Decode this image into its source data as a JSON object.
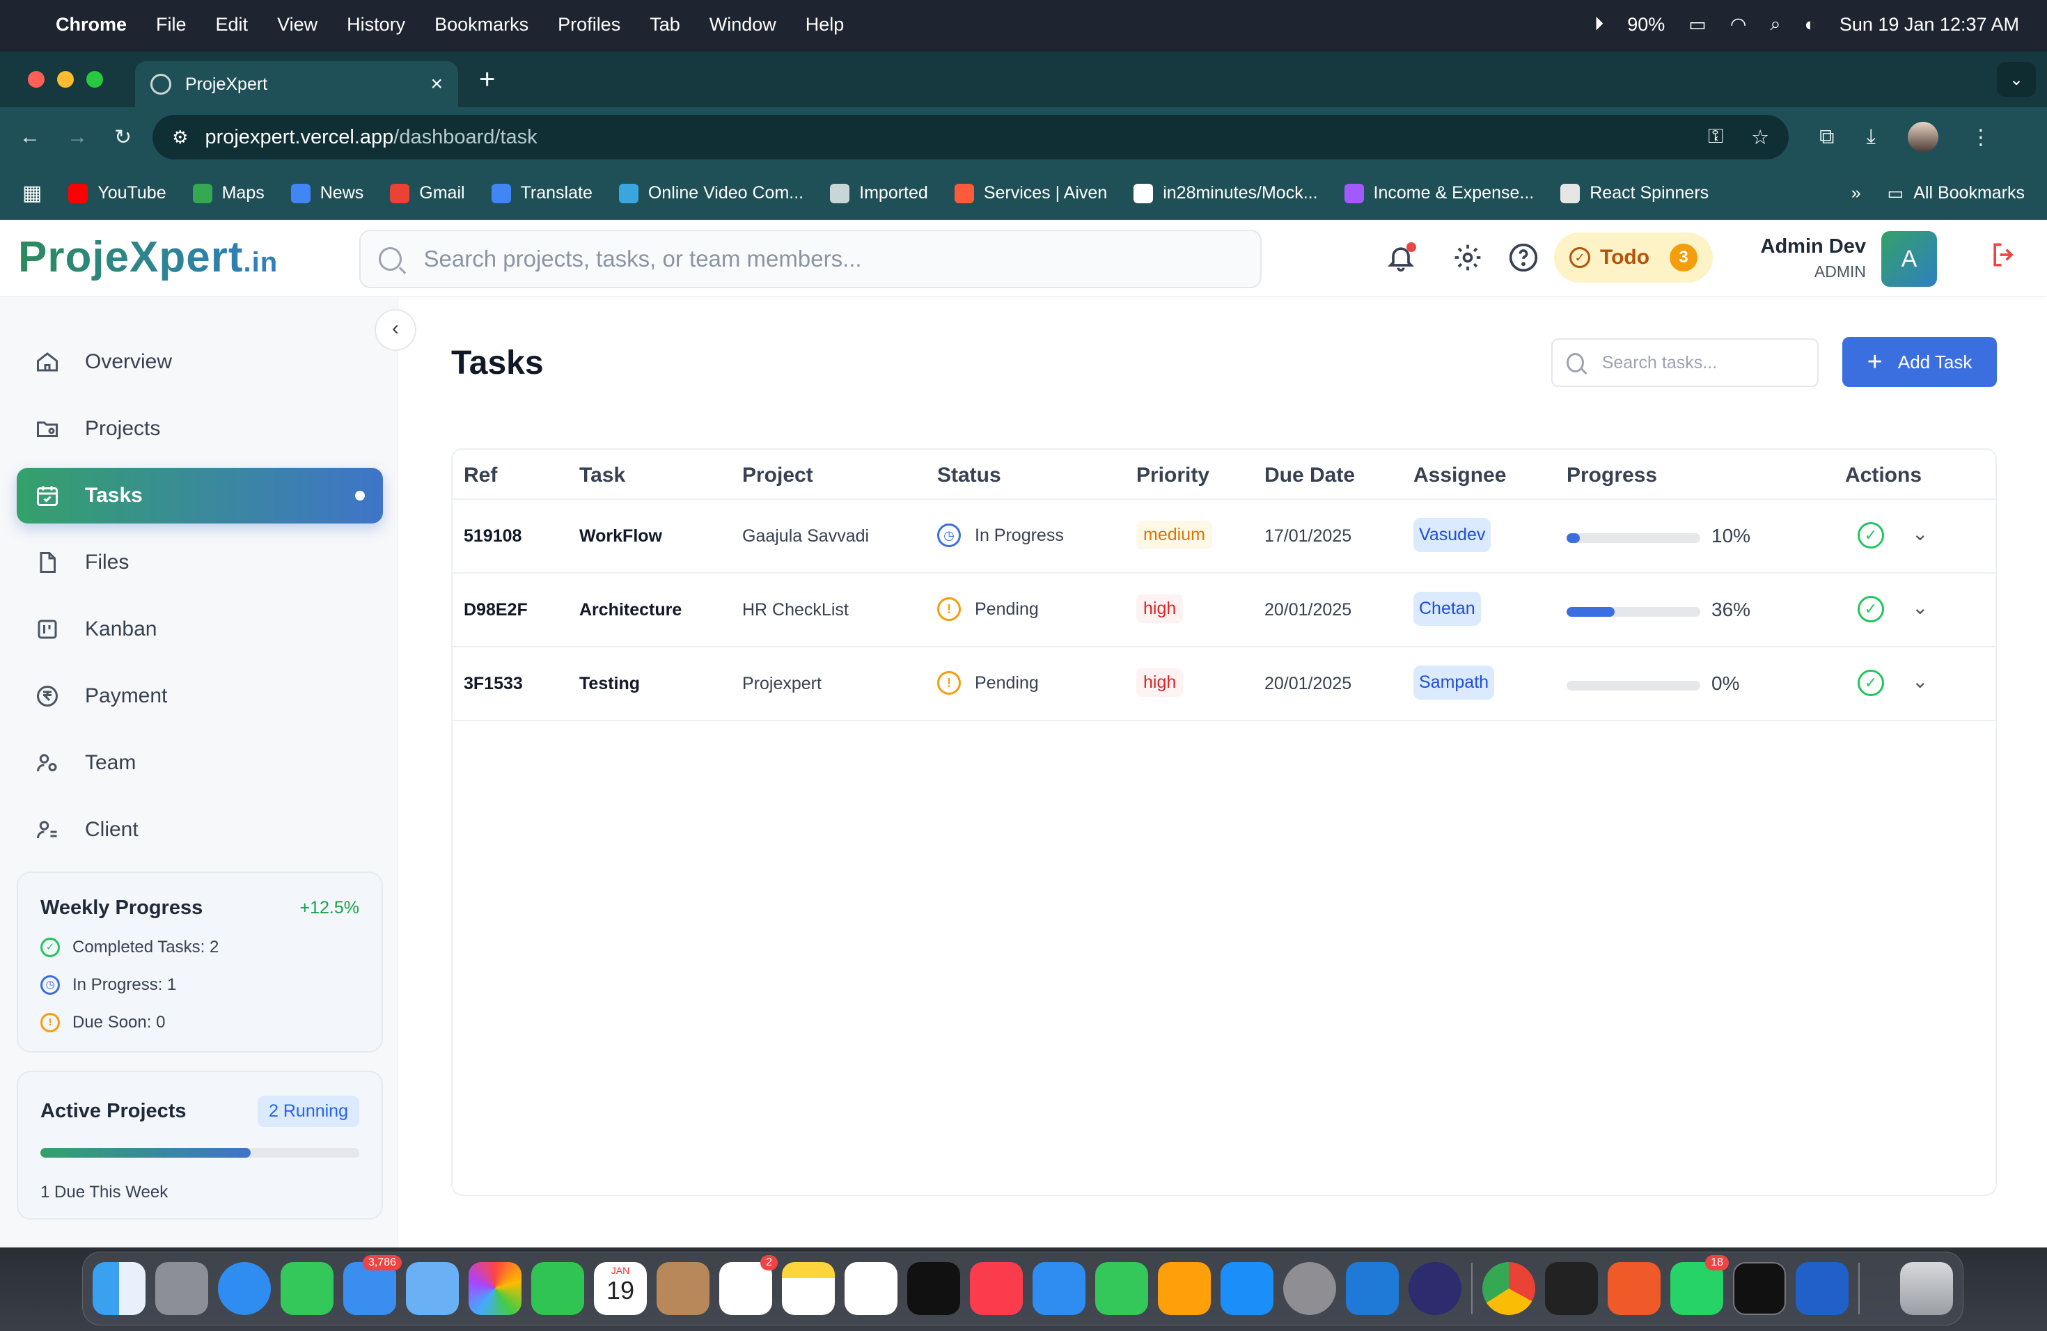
{
  "menubar": {
    "app": "Chrome",
    "items": [
      "File",
      "Edit",
      "View",
      "History",
      "Bookmarks",
      "Profiles",
      "Tab",
      "Window",
      "Help"
    ],
    "battery": "90%",
    "datetime": "Sun 19 Jan  12:37 AM"
  },
  "browser": {
    "tab_title": "ProjeXpert",
    "url_host": "projexpert.vercel.app",
    "url_path": "/dashboard/task",
    "bookmarks": [
      {
        "label": "YouTube",
        "color": "#ff0000"
      },
      {
        "label": "Maps",
        "color": "#34a853"
      },
      {
        "label": "News",
        "color": "#4285f4"
      },
      {
        "label": "Gmail",
        "color": "#ea4335"
      },
      {
        "label": "Translate",
        "color": "#4285f4"
      },
      {
        "label": "Online Video Com...",
        "color": "#3aa6e0"
      },
      {
        "label": "Imported",
        "color": "#c8d6d8"
      },
      {
        "label": "Services | Aiven",
        "color": "#ff5a3c"
      },
      {
        "label": "in28minutes/Mock...",
        "color": "#ffffff"
      },
      {
        "label": "Income & Expense...",
        "color": "#a259ff"
      },
      {
        "label": "React Spinners",
        "color": "#e6e6e6"
      }
    ],
    "all_bookmarks": "All Bookmarks"
  },
  "app": {
    "logo_main": "ProjeXpert",
    "logo_suffix": ".in",
    "search_placeholder": "Search projects, tasks, or team members...",
    "todo_label": "Todo",
    "todo_count": "3",
    "user_name": "Admin Dev",
    "user_role": "ADMIN",
    "user_initial": "A"
  },
  "sidebar": {
    "items": [
      {
        "label": "Overview",
        "icon": "home-icon"
      },
      {
        "label": "Projects",
        "icon": "folder-user-icon"
      },
      {
        "label": "Tasks",
        "icon": "calendar-check-icon"
      },
      {
        "label": "Files",
        "icon": "file-icon"
      },
      {
        "label": "Kanban",
        "icon": "kanban-icon"
      },
      {
        "label": "Payment",
        "icon": "rupee-icon"
      },
      {
        "label": "Team",
        "icon": "team-icon"
      },
      {
        "label": "Client",
        "icon": "client-icon"
      }
    ],
    "weekly": {
      "title": "Weekly Progress",
      "change": "+12.5%",
      "completed": "Completed Tasks: 2",
      "in_progress": "In Progress: 1",
      "due_soon": "Due Soon: 0"
    },
    "active_projects": {
      "title": "Active Projects",
      "badge": "2 Running",
      "progress": 0.66,
      "subtitle": "1 Due This Week"
    }
  },
  "main": {
    "title": "Tasks",
    "search_placeholder": "Search tasks...",
    "add_label": "Add Task",
    "columns": [
      "Ref",
      "Task",
      "Project",
      "Status",
      "Priority",
      "Due Date",
      "Assignee",
      "Progress",
      "Actions"
    ],
    "rows": [
      {
        "ref": "519108",
        "task": "WorkFlow",
        "project": "Gaajula Savvadi",
        "status": "In Progress",
        "priority": "medium",
        "due": "17/01/2025",
        "assignee": "Vasudev",
        "progress": 10,
        "progress_label": "10%"
      },
      {
        "ref": "D98E2F",
        "task": "Architecture",
        "project": "HR CheckList",
        "status": "Pending",
        "priority": "high",
        "due": "20/01/2025",
        "assignee": "Chetan",
        "progress": 36,
        "progress_label": "36%"
      },
      {
        "ref": "3F1533",
        "task": "Testing",
        "project": "Projexpert",
        "status": "Pending",
        "priority": "high",
        "due": "20/01/2025",
        "assignee": "Sampath",
        "progress": 0,
        "progress_label": "0%"
      }
    ]
  },
  "dock": {
    "badges": {
      "mail": "3,786",
      "reminders": "2",
      "whatsapp": "18"
    },
    "calendar_month": "JAN",
    "calendar_day": "19"
  }
}
